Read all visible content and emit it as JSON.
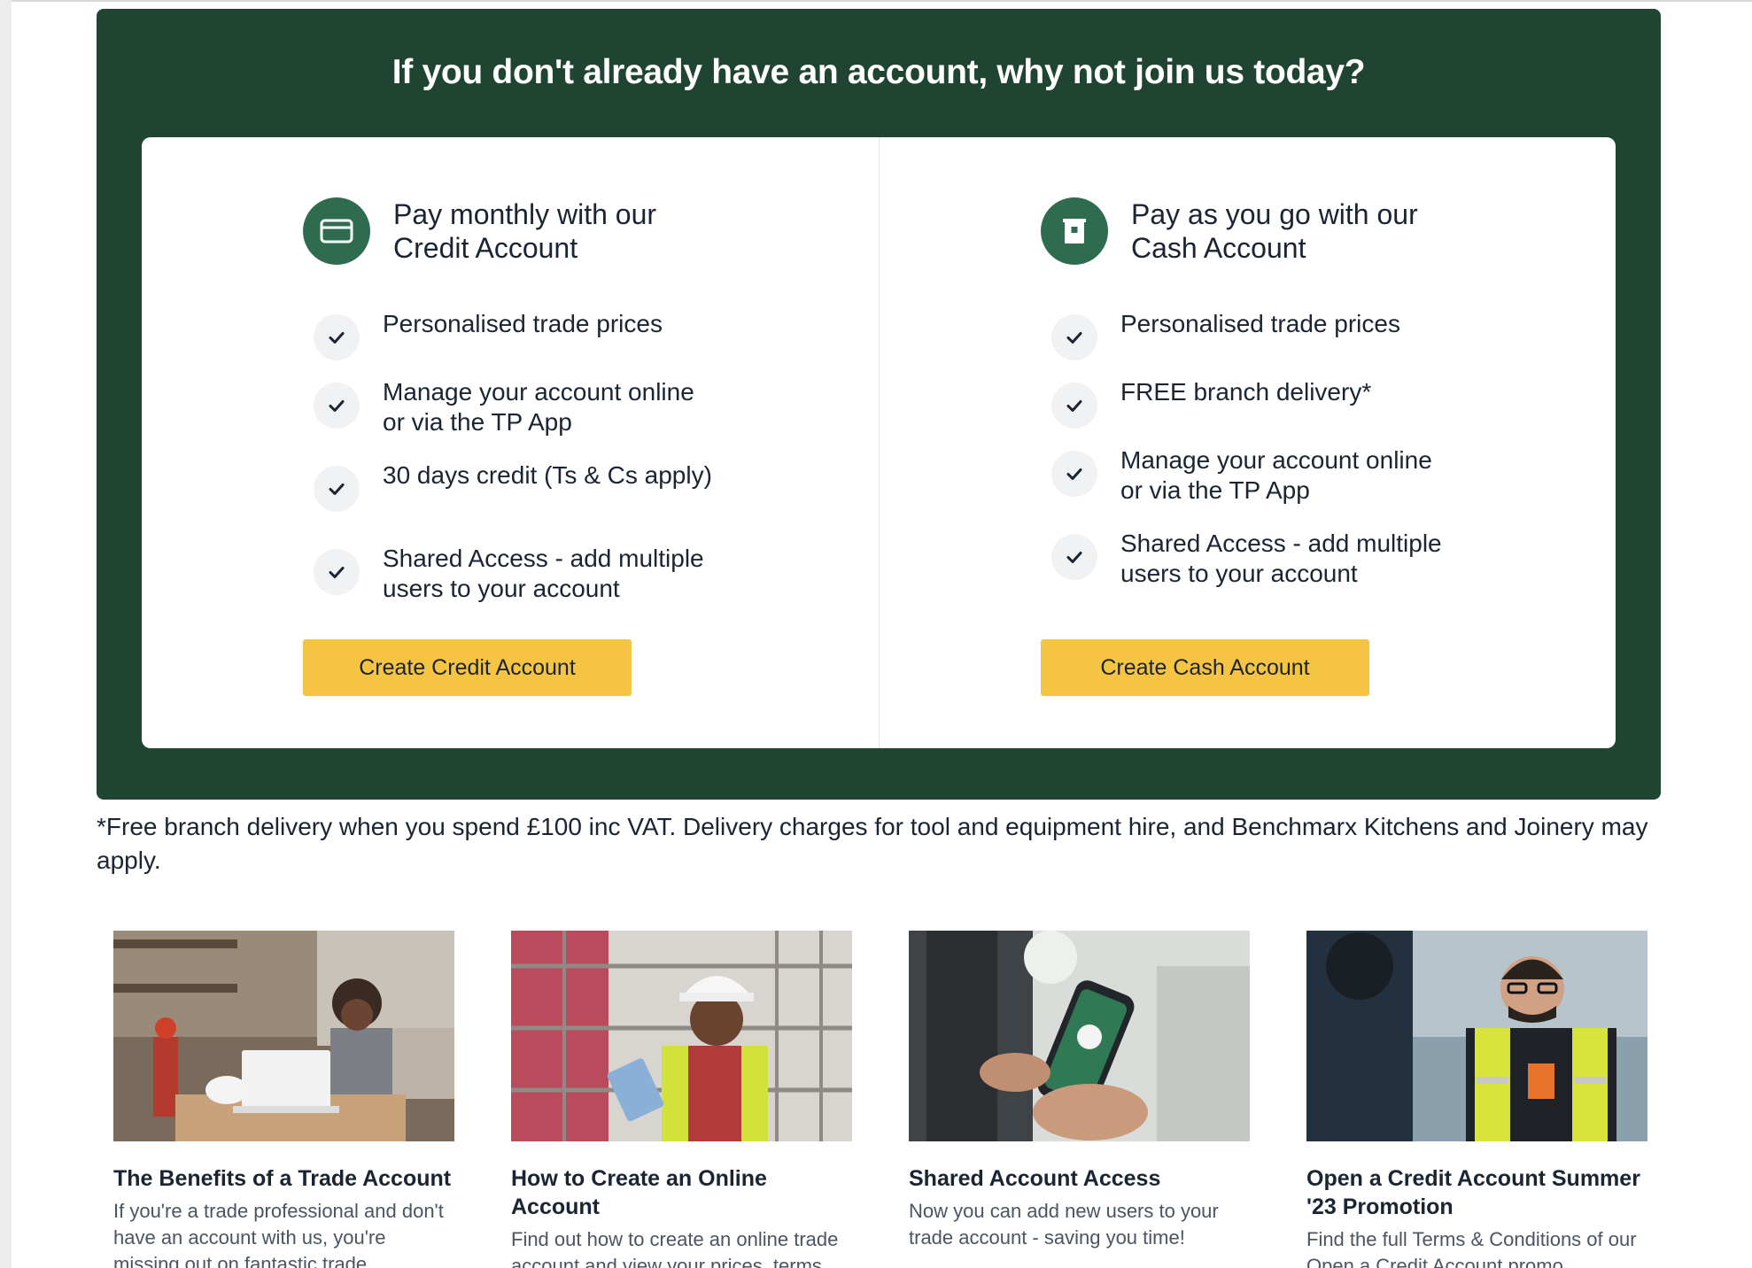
{
  "join": {
    "title": "If you don't already have an account, why not join us today?",
    "credit": {
      "heading": "Pay monthly with our Credit Account",
      "icon": "credit-card-icon",
      "features": [
        "Personalised trade prices",
        "Manage your account online or via the TP App",
        "30 days credit (Ts & Cs apply)",
        "Shared Access - add multiple users to your account"
      ],
      "button": "Create Credit Account"
    },
    "cash": {
      "heading": "Pay as you go with our Cash Account",
      "icon": "cash-register-icon",
      "features": [
        "Personalised trade prices",
        "FREE branch delivery*",
        "Manage your account online or via the TP App",
        "Shared Access - add multiple users to your account"
      ],
      "button": "Create Cash Account"
    }
  },
  "footnote": "*Free branch delivery when you spend £100 inc VAT. Delivery charges for tool and equipment hire, and Benchmarx Kitchens and Joinery may apply.",
  "articles": [
    {
      "title": "The Benefits of a Trade Account",
      "description": "If you're a trade professional and don't have an account with us, you're missing out on fantastic trade discounts!"
    },
    {
      "title": "How to Create an Online Account",
      "description": "Find out how to create an online trade account and view your prices, terms and invoices in one place."
    },
    {
      "title": "Shared Account Access",
      "description": "Now you can add new users to your trade account - saving you time!"
    },
    {
      "title": "Open a Credit Account Summer '23 Promotion",
      "description": "Find the full Terms & Conditions of our Open a Credit Account promo"
    }
  ],
  "colors": {
    "panel": "#1f4532",
    "icon_circle": "#2f6b4f",
    "button": "#f5c443",
    "text": "#1a2433"
  }
}
